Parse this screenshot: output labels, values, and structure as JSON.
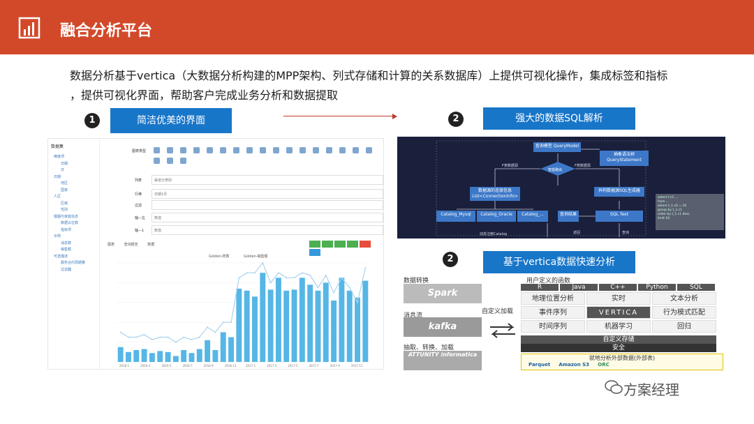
{
  "header": {
    "title": "融合分析平台",
    "bg_color": "#d2492a",
    "logo_icon": "bar-chart-icon"
  },
  "intro": {
    "line1": "数据分析基于vertica（大数据分析构建的MPP架构、列式存储和计算的关系数据库）上提供可视化操作，集成标签和指标",
    "line2": "，提供可视化界面，帮助客户完成业务分析和数据提取"
  },
  "section1": {
    "number": "1",
    "label": "简洁优美的界面"
  },
  "section2": {
    "number": "2",
    "label": "强大的数据SQL解析"
  },
  "section3": {
    "number": "2",
    "label": "基于vertica数据快速分析"
  },
  "accent_color": "#1876c9",
  "panel1": {
    "sidebar_title": "数据集",
    "tree": [
      "维度项",
      "日期",
      "日",
      "日期",
      "地区",
      "国家",
      "人区",
      "区域",
      "性别",
      "婚姻与家庭信息",
      "数据占位数",
      "指标项",
      "示例",
      "消息数",
      "销售额",
      "可选描述",
      "服务合约周期量",
      "过滤器"
    ],
    "chart_type_label": "图表类型",
    "rows": [
      {
        "label": "列表",
        "value": "渠道分类别"
      },
      {
        "label": "行维",
        "value": "日期1月"
      },
      {
        "label": "过滤",
        "value": ""
      },
      {
        "label": "轴—左",
        "value": "数值"
      },
      {
        "label": "轴—1",
        "value": "数值"
      }
    ],
    "tabs": [
      "图表",
      "查询报告",
      "数据"
    ],
    "legend": [
      "Golden-样数",
      "Golden-销售额"
    ]
  },
  "panel2": {
    "boxes": [
      "查询模型 QueryModel",
      "抽象语法树 QueryStatement",
      "数据源的连接信息 List<ConnectionInfo>",
      "异构数据源SQL生成器",
      "Catalog_Mysql",
      "Catalog_Oracle",
      "Catalog_...",
      "查询结果",
      "SQL Text"
    ],
    "labels": [
      "F类数据源",
      "F类数据源",
      "智能路由",
      "动态注册Catalog",
      "返回",
      "查询"
    ]
  },
  "panel3": {
    "source_label1": "数据转换",
    "source_label2": "消息流",
    "source_label3": "抽取、转换、加载",
    "spark": "Spark",
    "kafka": "kafka",
    "informatica": "ATTUNITY informatica",
    "custom_load": "自定义加载",
    "udf_title": "用户定义的函数",
    "langs": [
      "R",
      "Java",
      "C++",
      "Python",
      "SQL"
    ],
    "cells": [
      "地理位置分析",
      "实时",
      "文本分析",
      "事件序列",
      "VERTICA",
      "行为模式匹配",
      "时间序列",
      "机器学习",
      "回归"
    ],
    "storage": "自定义存储",
    "security": "安全",
    "external": "就地分析外部数据(外部表)",
    "formats": [
      "Parquet",
      "Amazon S3",
      "ORC"
    ]
  },
  "watermark": "方案经理",
  "chart_data": {
    "type": "bar",
    "title": "",
    "legend": [
      "Golden-样数",
      "Golden-销售额"
    ],
    "categories": [
      "2016-1",
      "2016-3",
      "2016-5",
      "2016-7",
      "2016-9",
      "2016-11",
      "2017-1",
      "2017-3",
      "2017-5",
      "2017-7",
      "2017-9",
      "2017-11"
    ],
    "series": [
      {
        "name": "Golden-样数",
        "values": [
          350,
          300,
          320,
          330,
          290,
          310,
          300,
          260,
          320,
          290,
          330,
          420,
          320,
          500,
          450,
          940,
          920,
          860,
          1100,
          930,
          1050,
          920,
          930,
          1050,
          980,
          920,
          1000,
          820,
          1050,
          920,
          850,
          1020
        ]
      },
      {
        "name": "Golden-销售额",
        "values": [
          1.4,
          1.3,
          1.3,
          1.35,
          1.25,
          1.3,
          1.3,
          1.2,
          1.3,
          1.25,
          1.3,
          1.5,
          1.4,
          1.6,
          1.6,
          2.5,
          2.6,
          2.6,
          2.8,
          2.4,
          2.6,
          2.5,
          2.5,
          2.6,
          2.55,
          2.3,
          2.55,
          2.2,
          2.5,
          2.3,
          2.0,
          2.7
        ]
      }
    ],
    "ylim": [
      200,
      1200
    ],
    "y2lim": [
      0.8,
      2.8
    ]
  }
}
